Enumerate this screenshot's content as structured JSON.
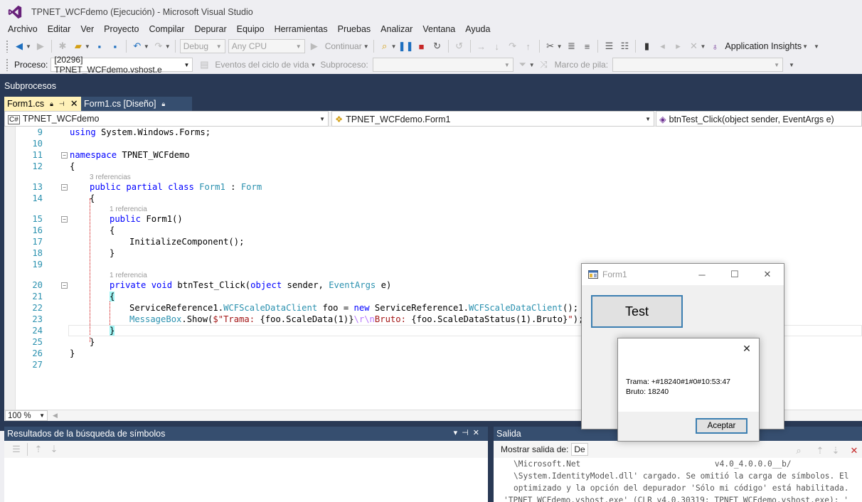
{
  "window": {
    "title": "TPNET_WCFdemo (Ejecución) - Microsoft Visual Studio"
  },
  "menu": [
    "Archivo",
    "Editar",
    "Ver",
    "Proyecto",
    "Compilar",
    "Depurar",
    "Equipo",
    "Herramientas",
    "Pruebas",
    "Analizar",
    "Ventana",
    "Ayuda"
  ],
  "toolbar": {
    "config": "Debug",
    "platform": "Any CPU",
    "continue_label": "Continuar",
    "app_insights_label": "Application Insights"
  },
  "debug_toolbar": {
    "process_label": "Proceso:",
    "process_value": "[20296] TPNET_WCFdemo.vshost.e",
    "lifecycle_label": "Eventos del ciclo de vida",
    "thread_label": "Subproceso:",
    "stack_label": "Marco de pila:"
  },
  "threads_panel_label": "Subprocesos",
  "tabs": [
    {
      "label": "Form1.cs",
      "active": true
    },
    {
      "label": "Form1.cs [Diseño]",
      "active": false
    }
  ],
  "nav": {
    "project": "TPNET_WCFdemo",
    "class": "TPNET_WCFdemo.Form1",
    "member": "btnTest_Click(object sender, EventArgs e)"
  },
  "code": {
    "line_numbers": [
      "9",
      "10",
      "11",
      "12",
      "13",
      "14",
      "15",
      "16",
      "17",
      "18",
      "19",
      "20",
      "21",
      "22",
      "23",
      "24",
      "25",
      "26",
      "27"
    ],
    "ref_hints": [
      "3 referencias",
      "1 referencia",
      "1 referencia"
    ],
    "l9_using": "using",
    "l9_rest": " System.Windows.Forms;",
    "l11_kw": "namespace",
    "l11_rest": " TPNET_WCFdemo",
    "l12": "{",
    "l13_kw1": "public",
    "l13_kw2": "partial",
    "l13_kw3": "class",
    "l13_type": "Form1",
    "l13_colon": " : ",
    "l13_base": "Form",
    "l14": "{",
    "l15_kw": "public",
    "l15_rest": " Form1()",
    "l16": "{",
    "l17": "InitializeComponent();",
    "l18": "}",
    "l20_kw1": "private",
    "l20_kw2": "void",
    "l20_name": " btnTest_Click(",
    "l20_kw3": "object",
    "l20_mid": " sender, ",
    "l20_type": "EventArgs",
    "l20_end": " e)",
    "l21": "{",
    "l22_a": "ServiceReference1.",
    "l22_type1": "WCFScaleDataClient",
    "l22_b": " foo = ",
    "l22_kw": "new",
    "l22_c": " ServiceReference1.",
    "l22_type2": "WCFScaleDataClient",
    "l22_d": "();",
    "l23_type": "MessageBox",
    "l23_a": ".Show(",
    "l23_str1": "$\"Trama: ",
    "l23_b": "{foo.ScaleData(1)}",
    "l23_esc": "\\r\\n",
    "l23_str2": "Bruto: ",
    "l23_c": "{foo.ScaleDataStatus(1).Bruto}",
    "l23_str3": "\"",
    "l23_d": ");",
    "l24": "}",
    "l25": "}",
    "l26": "}"
  },
  "zoom": "100 %",
  "symbols_panel": {
    "title": "Resultados de la búsqueda de símbolos"
  },
  "output_panel": {
    "title": "Salida",
    "show_from_label": "Mostrar salida de:",
    "show_from_value": "De",
    "lines": [
      "\\Microsoft.Net                            v4.0_4.0.0.0__b/",
      "\\System.IdentityModel.dll' cargado. Se omitió la carga de símbolos. El",
      "optimizado y la opción del depurador 'Sólo mi código' está habilitada.",
      "'TPNET_WCFdemo.vshost.exe' (CLR v4.0.30319: TPNET_WCFdemo.vshost.exe): '"
    ]
  },
  "form1": {
    "title": "Form1",
    "button_label": "Test"
  },
  "messagebox": {
    "line1": "Trama: +#18240#1#0#10:53:47",
    "line2": "Bruto: 18240",
    "ok_label": "Aceptar"
  }
}
